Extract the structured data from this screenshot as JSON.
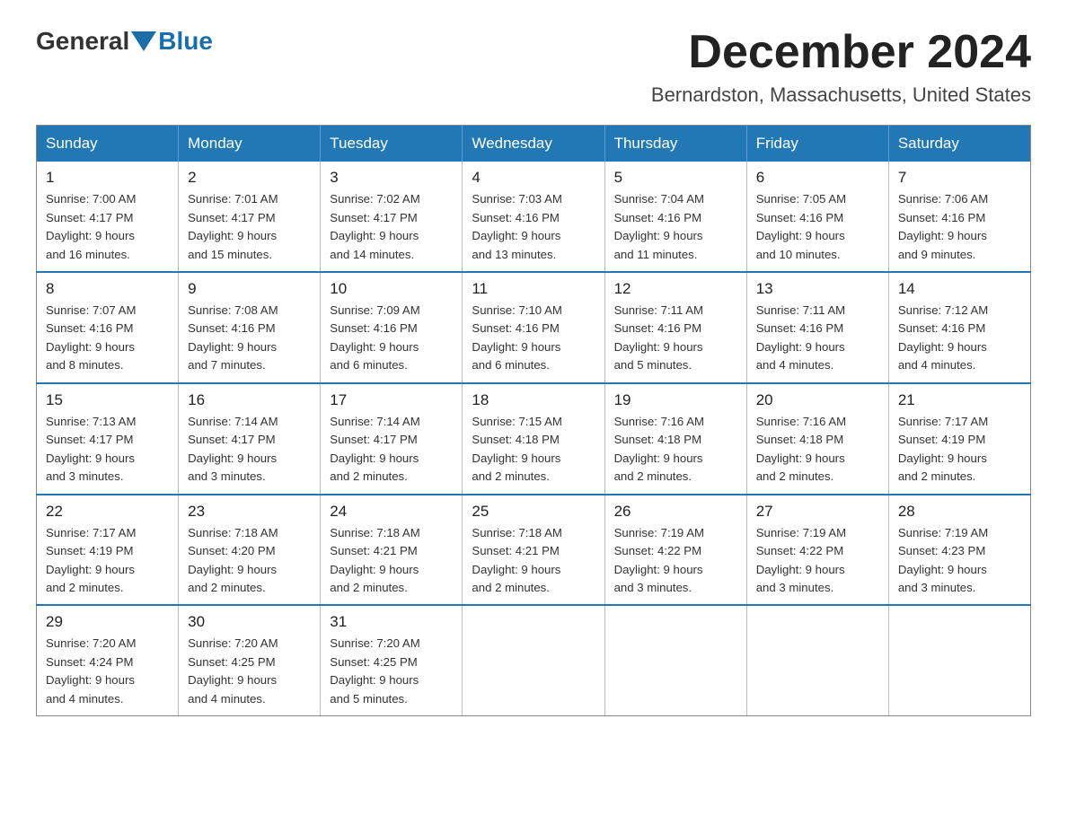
{
  "header": {
    "logo_general": "General",
    "logo_blue": "Blue",
    "month_title": "December 2024",
    "location": "Bernardston, Massachusetts, United States"
  },
  "weekdays": [
    "Sunday",
    "Monday",
    "Tuesday",
    "Wednesday",
    "Thursday",
    "Friday",
    "Saturday"
  ],
  "weeks": [
    [
      {
        "day": "1",
        "sunrise": "7:00 AM",
        "sunset": "4:17 PM",
        "daylight": "9 hours and 16 minutes."
      },
      {
        "day": "2",
        "sunrise": "7:01 AM",
        "sunset": "4:17 PM",
        "daylight": "9 hours and 15 minutes."
      },
      {
        "day": "3",
        "sunrise": "7:02 AM",
        "sunset": "4:17 PM",
        "daylight": "9 hours and 14 minutes."
      },
      {
        "day": "4",
        "sunrise": "7:03 AM",
        "sunset": "4:16 PM",
        "daylight": "9 hours and 13 minutes."
      },
      {
        "day": "5",
        "sunrise": "7:04 AM",
        "sunset": "4:16 PM",
        "daylight": "9 hours and 11 minutes."
      },
      {
        "day": "6",
        "sunrise": "7:05 AM",
        "sunset": "4:16 PM",
        "daylight": "9 hours and 10 minutes."
      },
      {
        "day": "7",
        "sunrise": "7:06 AM",
        "sunset": "4:16 PM",
        "daylight": "9 hours and 9 minutes."
      }
    ],
    [
      {
        "day": "8",
        "sunrise": "7:07 AM",
        "sunset": "4:16 PM",
        "daylight": "9 hours and 8 minutes."
      },
      {
        "day": "9",
        "sunrise": "7:08 AM",
        "sunset": "4:16 PM",
        "daylight": "9 hours and 7 minutes."
      },
      {
        "day": "10",
        "sunrise": "7:09 AM",
        "sunset": "4:16 PM",
        "daylight": "9 hours and 6 minutes."
      },
      {
        "day": "11",
        "sunrise": "7:10 AM",
        "sunset": "4:16 PM",
        "daylight": "9 hours and 6 minutes."
      },
      {
        "day": "12",
        "sunrise": "7:11 AM",
        "sunset": "4:16 PM",
        "daylight": "9 hours and 5 minutes."
      },
      {
        "day": "13",
        "sunrise": "7:11 AM",
        "sunset": "4:16 PM",
        "daylight": "9 hours and 4 minutes."
      },
      {
        "day": "14",
        "sunrise": "7:12 AM",
        "sunset": "4:16 PM",
        "daylight": "9 hours and 4 minutes."
      }
    ],
    [
      {
        "day": "15",
        "sunrise": "7:13 AM",
        "sunset": "4:17 PM",
        "daylight": "9 hours and 3 minutes."
      },
      {
        "day": "16",
        "sunrise": "7:14 AM",
        "sunset": "4:17 PM",
        "daylight": "9 hours and 3 minutes."
      },
      {
        "day": "17",
        "sunrise": "7:14 AM",
        "sunset": "4:17 PM",
        "daylight": "9 hours and 2 minutes."
      },
      {
        "day": "18",
        "sunrise": "7:15 AM",
        "sunset": "4:18 PM",
        "daylight": "9 hours and 2 minutes."
      },
      {
        "day": "19",
        "sunrise": "7:16 AM",
        "sunset": "4:18 PM",
        "daylight": "9 hours and 2 minutes."
      },
      {
        "day": "20",
        "sunrise": "7:16 AM",
        "sunset": "4:18 PM",
        "daylight": "9 hours and 2 minutes."
      },
      {
        "day": "21",
        "sunrise": "7:17 AM",
        "sunset": "4:19 PM",
        "daylight": "9 hours and 2 minutes."
      }
    ],
    [
      {
        "day": "22",
        "sunrise": "7:17 AM",
        "sunset": "4:19 PM",
        "daylight": "9 hours and 2 minutes."
      },
      {
        "day": "23",
        "sunrise": "7:18 AM",
        "sunset": "4:20 PM",
        "daylight": "9 hours and 2 minutes."
      },
      {
        "day": "24",
        "sunrise": "7:18 AM",
        "sunset": "4:21 PM",
        "daylight": "9 hours and 2 minutes."
      },
      {
        "day": "25",
        "sunrise": "7:18 AM",
        "sunset": "4:21 PM",
        "daylight": "9 hours and 2 minutes."
      },
      {
        "day": "26",
        "sunrise": "7:19 AM",
        "sunset": "4:22 PM",
        "daylight": "9 hours and 3 minutes."
      },
      {
        "day": "27",
        "sunrise": "7:19 AM",
        "sunset": "4:22 PM",
        "daylight": "9 hours and 3 minutes."
      },
      {
        "day": "28",
        "sunrise": "7:19 AM",
        "sunset": "4:23 PM",
        "daylight": "9 hours and 3 minutes."
      }
    ],
    [
      {
        "day": "29",
        "sunrise": "7:20 AM",
        "sunset": "4:24 PM",
        "daylight": "9 hours and 4 minutes."
      },
      {
        "day": "30",
        "sunrise": "7:20 AM",
        "sunset": "4:25 PM",
        "daylight": "9 hours and 4 minutes."
      },
      {
        "day": "31",
        "sunrise": "7:20 AM",
        "sunset": "4:25 PM",
        "daylight": "9 hours and 5 minutes."
      },
      null,
      null,
      null,
      null
    ]
  ]
}
